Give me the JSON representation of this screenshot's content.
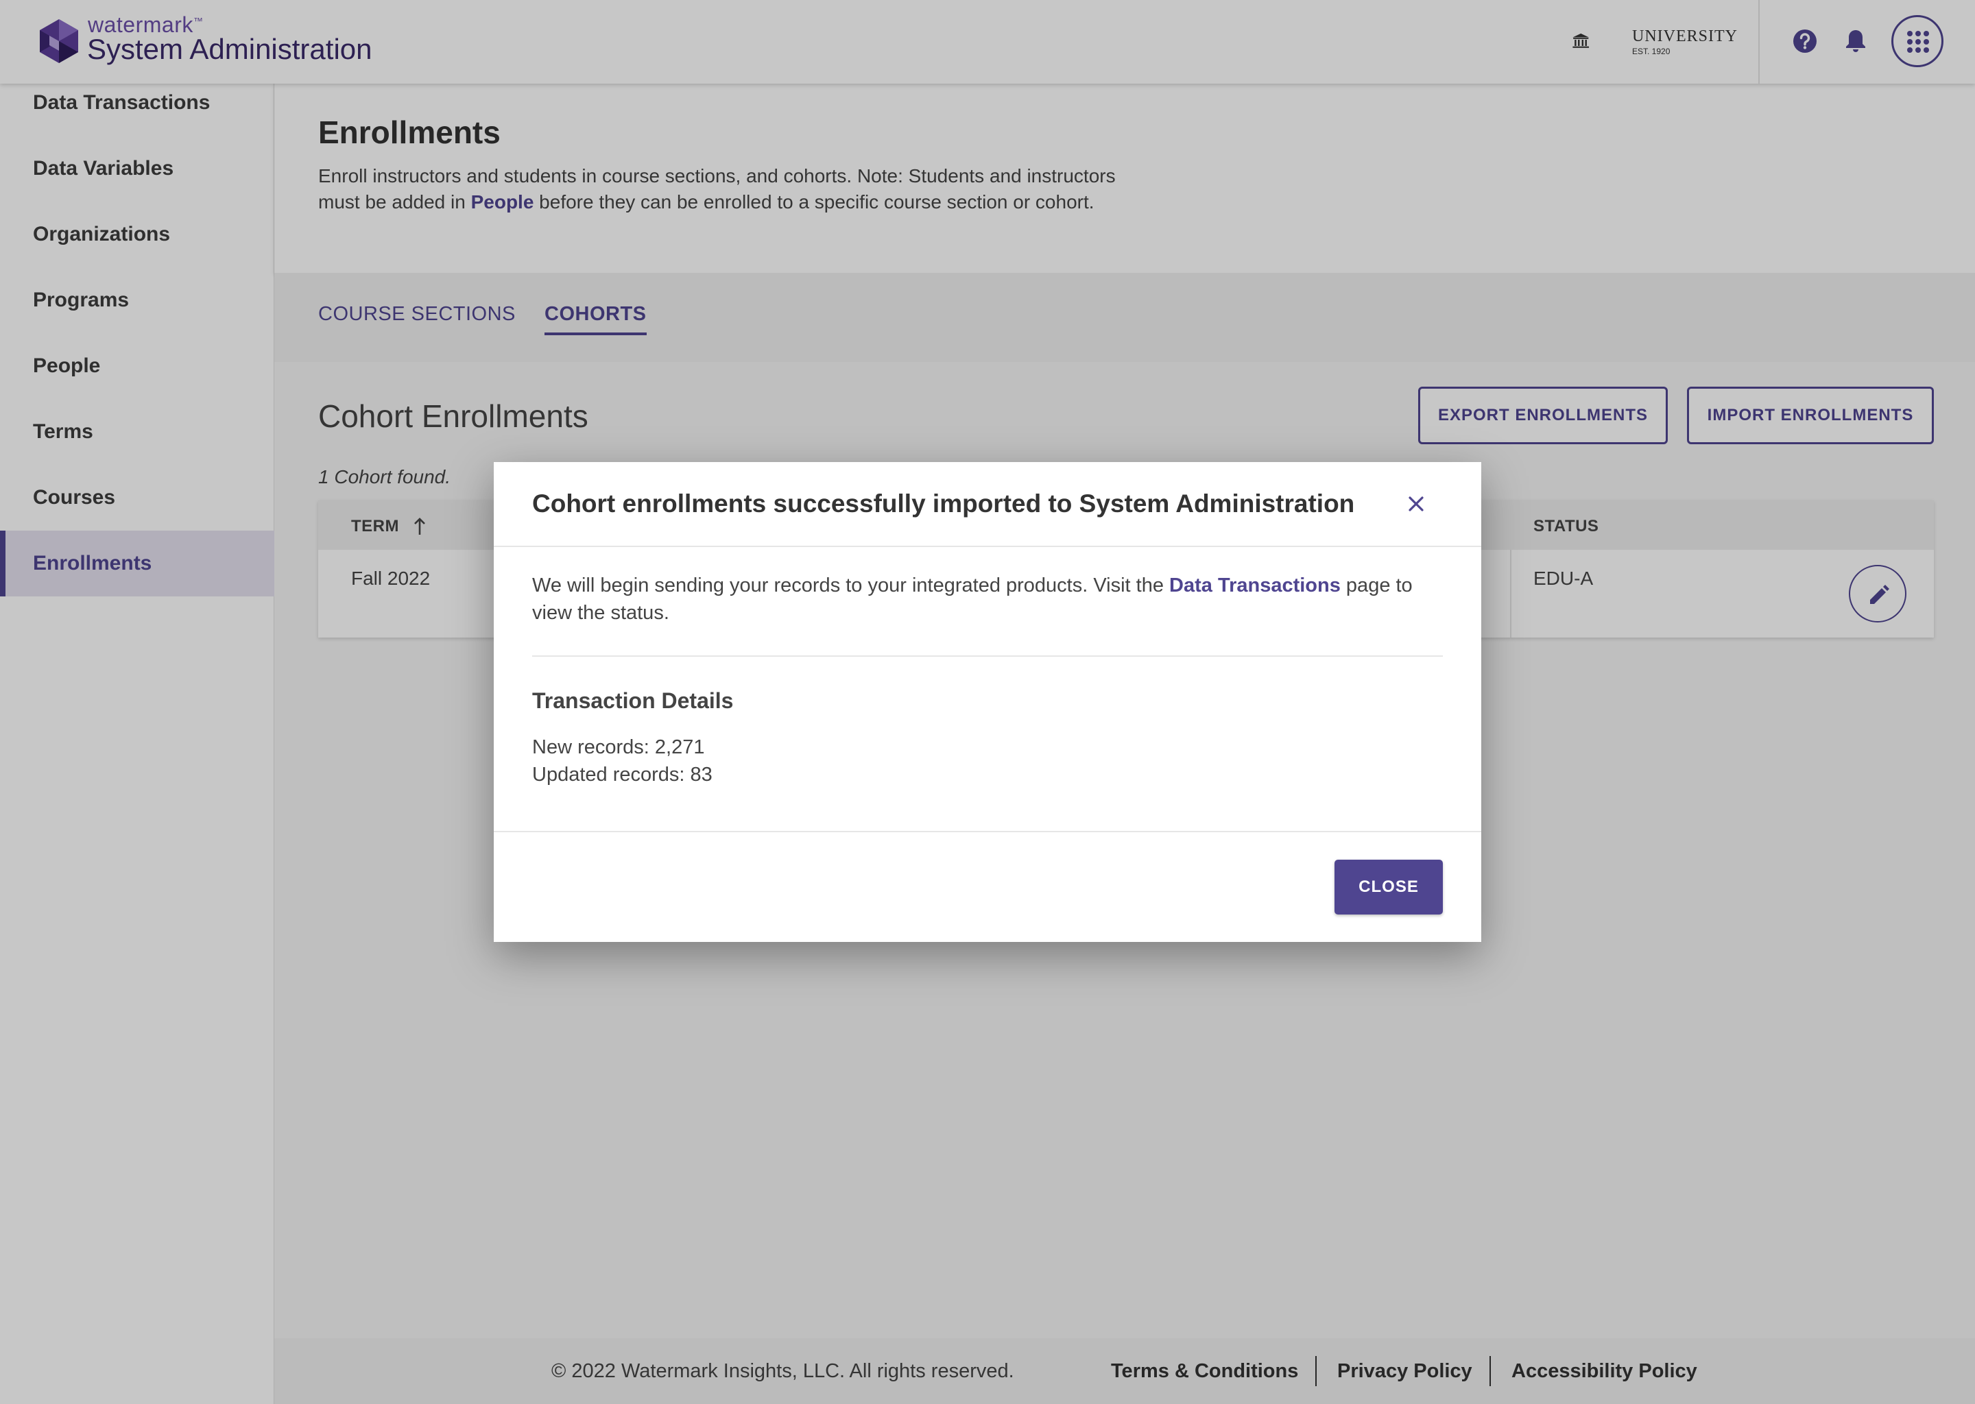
{
  "header": {
    "brand_small": "watermark",
    "brand_tm": "™",
    "app_title": "System Administration",
    "university_name": "UNIVERSITY",
    "university_est": "EST. 1920"
  },
  "sidebar": {
    "items": [
      {
        "label": "Data Transactions"
      },
      {
        "label": "Data Variables"
      },
      {
        "label": "Organizations"
      },
      {
        "label": "Programs"
      },
      {
        "label": "People"
      },
      {
        "label": "Terms"
      },
      {
        "label": "Courses"
      },
      {
        "label": "Enrollments"
      }
    ],
    "active": "Enrollments"
  },
  "page": {
    "title": "Enrollments",
    "desc_before": "Enroll instructors and students in course sections, and cohorts. Note: Students and instructors must be added in ",
    "desc_link": "People",
    "desc_after": " before they can be enrolled to a specific course section or cohort."
  },
  "tabs": {
    "course_sections": "COURSE SECTIONS",
    "cohorts": "COHORTS"
  },
  "content": {
    "title": "Cohort Enrollments",
    "export_label": "EXPORT ENROLLMENTS",
    "import_label": "IMPORT ENROLLMENTS",
    "count_text": "1 Cohort found.",
    "table": {
      "headers": {
        "term": "TERM",
        "status": "STATUS"
      },
      "rows": [
        {
          "term": "Fall 2022",
          "status": "EDU-A"
        }
      ]
    }
  },
  "footer": {
    "copyright": "© 2022 Watermark Insights, LLC. All rights reserved.",
    "terms": "Terms & Conditions",
    "privacy": "Privacy Policy",
    "accessibility": "Accessibility Policy"
  },
  "modal": {
    "title": "Cohort enrollments successfully imported to System Administration",
    "msg_before": "We will begin sending your records to your integrated products. Visit the ",
    "msg_link": "Data Transactions",
    "msg_after": " page to view the status.",
    "details_title": "Transaction Details",
    "new_records": "New records: 2,271",
    "updated_records": "Updated records: 83",
    "close_label": "CLOSE"
  },
  "colors": {
    "accent": "#4f4590",
    "brand_purple": "#6b4fa8"
  },
  "icons": [
    "watermark-logo-icon",
    "university-building-icon",
    "help-icon",
    "bell-icon",
    "apps-grid-icon",
    "sort-arrow-up-icon",
    "edit-pencil-icon",
    "close-icon"
  ]
}
